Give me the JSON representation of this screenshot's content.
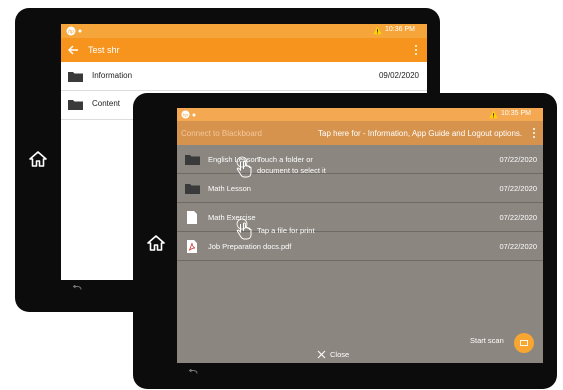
{
  "back_screen": {
    "status_time": "10:36 PM",
    "title": "Test shr",
    "items": [
      {
        "name": "Information",
        "date": "09/02/2020"
      },
      {
        "name": "Content",
        "date": ""
      }
    ]
  },
  "front_screen": {
    "status_time": "10:35 PM",
    "app_title": "Connect to Blackboard",
    "hint": "Tap here for - Information, App Guide and Logout options.",
    "items": [
      {
        "name": "English Lesson",
        "date": "07/22/2020",
        "type": "folder"
      },
      {
        "name": "Math Lesson",
        "date": "07/22/2020",
        "type": "folder"
      },
      {
        "name": "Math Exercise",
        "date": "07/22/2020",
        "type": "document"
      },
      {
        "name": "Job Preparation docs.pdf",
        "date": "07/22/2020",
        "type": "pdf"
      }
    ],
    "tip_folder": "Touch a folder or document to select it",
    "tip_file": "Tap a file for print",
    "start_scan": "Start scan",
    "close": "Close"
  },
  "icons": [
    "hp-logo-icon",
    "warning-icon",
    "back-arrow-icon",
    "folder-icon",
    "document-icon",
    "pdf-icon",
    "home-icon",
    "hand-pointer-icon",
    "close-icon",
    "kebab-menu-icon",
    "scan-icon",
    "nav-back-icon"
  ],
  "colors": {
    "accent": "#f7941d",
    "status_bar": "#f6a53a",
    "dimmed_overlay": "#8b8680"
  }
}
